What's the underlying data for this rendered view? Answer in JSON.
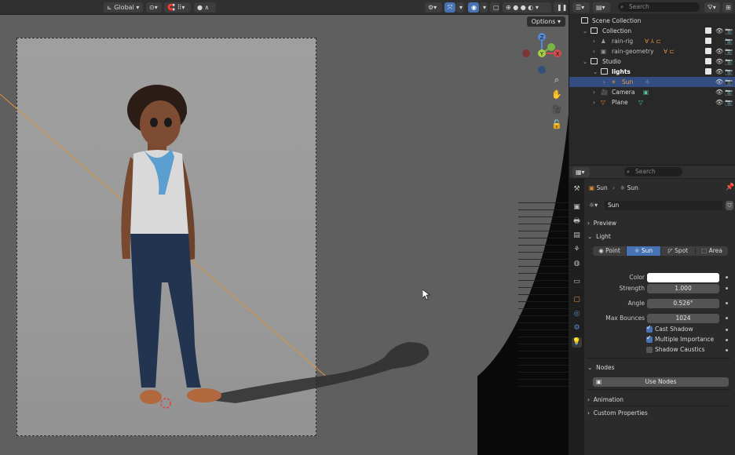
{
  "viewport": {
    "header": {
      "orientation": "Global",
      "options_label": "Options"
    },
    "gizmo": {
      "z": "Z",
      "y": "Y",
      "x": "X"
    }
  },
  "outliner": {
    "search_placeholder": "Search",
    "rows": [
      {
        "label": "Scene Collection"
      },
      {
        "label": "Collection"
      },
      {
        "label": "rain-rig"
      },
      {
        "label": "rain-geometry"
      },
      {
        "label": "Studio"
      },
      {
        "label": "lights"
      },
      {
        "label": "Sun"
      },
      {
        "label": "Camera"
      },
      {
        "label": "Plane"
      }
    ]
  },
  "properties": {
    "search_placeholder": "Search",
    "breadcrumb": {
      "object": "Sun",
      "data": "Sun"
    },
    "datablock_name": "Sun",
    "panels": {
      "preview": "Preview",
      "light": "Light",
      "nodes": "Nodes",
      "animation": "Animation",
      "custom_properties": "Custom Properties"
    },
    "light_types": [
      "Point",
      "Sun",
      "Spot",
      "Area"
    ],
    "active_light_type": "Sun",
    "fields": {
      "color_label": "Color",
      "color_value": "#ffffff",
      "strength_label": "Strength",
      "strength_value": "1.000",
      "angle_label": "Angle",
      "angle_value": "0.526°",
      "max_bounces_label": "Max Bounces",
      "max_bounces_value": "1024"
    },
    "checkboxes": {
      "cast_shadow": "Cast Shadow",
      "multiple_importance": "Multiple Importance",
      "shadow_caustics": "Shadow Caustics"
    },
    "use_nodes": "Use Nodes"
  }
}
